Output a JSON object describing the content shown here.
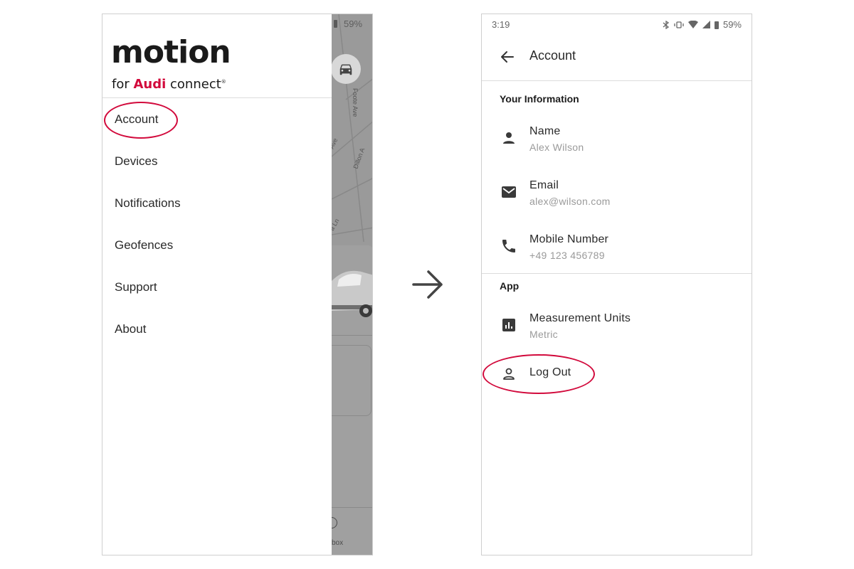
{
  "left_screen": {
    "status": {
      "battery": "59%"
    },
    "logo": {
      "main": "motion",
      "sub_prefix": "for ",
      "sub_brand": "Audi",
      "sub_suffix": " connect",
      "trademark": "®"
    },
    "menu": [
      {
        "label": "Account"
      },
      {
        "label": "Devices"
      },
      {
        "label": "Notifications"
      },
      {
        "label": "Geofences"
      },
      {
        "label": "Support"
      },
      {
        "label": "About"
      }
    ],
    "map": {
      "street_1": "Foote Ave",
      "street_2": "Ave",
      "street_3": "Dillon A",
      "street_4": "a Ln",
      "bottom_label": "box"
    }
  },
  "right_screen": {
    "status": {
      "time": "3:19",
      "battery": "59%"
    },
    "title": "Account",
    "sections": [
      {
        "header": "Your Information",
        "rows": [
          {
            "title": "Name",
            "subtitle": "Alex Wilson",
            "icon": "person-icon"
          },
          {
            "title": "Email",
            "subtitle": "alex@wilson.com",
            "icon": "email-icon"
          },
          {
            "title": "Mobile Number",
            "subtitle": "+49 123 456789",
            "icon": "phone-icon"
          }
        ]
      },
      {
        "header": "App",
        "rows": [
          {
            "title": "Measurement Units",
            "subtitle": "Metric",
            "icon": "chart-icon"
          },
          {
            "title": "Log Out",
            "icon": "person-outline-icon"
          }
        ]
      }
    ]
  },
  "colors": {
    "accent": "#d20a3c",
    "map_overlay": "#9a9a9a",
    "divider": "#dcdcdc"
  }
}
